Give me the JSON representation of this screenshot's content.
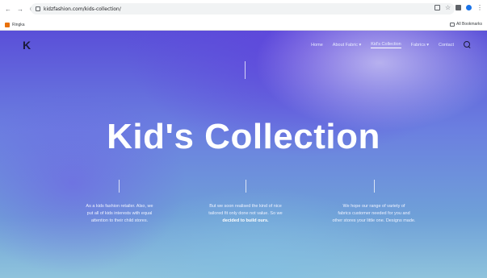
{
  "browser": {
    "nav": [
      "←",
      "→",
      "C"
    ],
    "url": "kidzfashion.com/kids-collection/",
    "bookmark": "Ringka",
    "bookmarks_folder": "All Bookmarks"
  },
  "site": {
    "logo": "K",
    "menu": [
      {
        "label": "Home"
      },
      {
        "label": "About Fabric ▾"
      },
      {
        "label": "Kid's Collection"
      },
      {
        "label": "Fabrics ▾"
      },
      {
        "label": "Contact"
      }
    ]
  },
  "hero": {
    "title": "Kid's Collection"
  },
  "columns": [
    {
      "lines": [
        "As a kids fashion retailer. Also, we",
        "put all of kids interests with equal",
        "attention to their child stores."
      ]
    },
    {
      "lines": [
        "But we soon realised the kind of nice",
        "tailored fit only done not value. So we"
      ],
      "bold": "decided to build ours."
    },
    {
      "lines": [
        "We hope our range of variety of",
        "fabrics customer needed for you and",
        "other stores your little one. Designs made."
      ]
    }
  ]
}
